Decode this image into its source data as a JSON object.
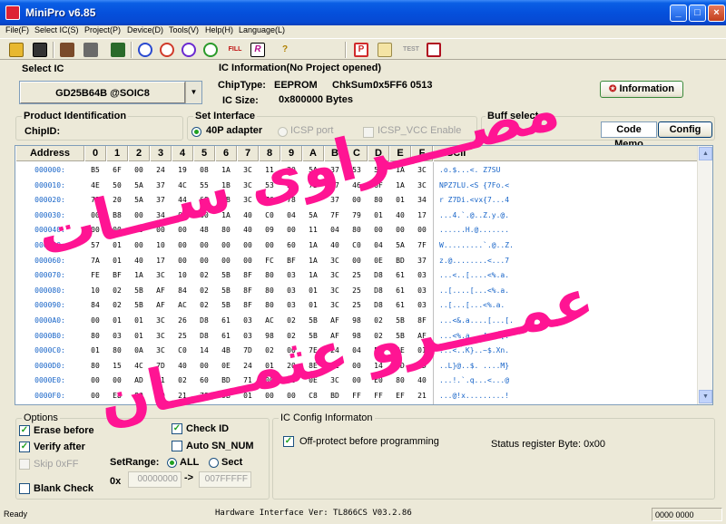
{
  "window": {
    "title": "MiniPro v6.85",
    "min": "_",
    "max": "□",
    "close": "×"
  },
  "menu": [
    "File(F)",
    "Select IC(S)",
    "Project(P)",
    "Device(D)",
    "Tools(V)",
    "Help(H)",
    "Language(L)"
  ],
  "toolbar": {
    "icons": [
      "open-icon",
      "save-icon",
      "project-icon",
      "save-project-icon",
      "chip-icon",
      "read-icon",
      "erase-icon",
      "blank-icon",
      "verify-icon",
      "fill-icon",
      "edit-icon",
      "help-icon",
      "program-icon",
      "notes-icon",
      "test-icon",
      "chip-test-icon"
    ],
    "fill_label": "FILL",
    "test_label": "TEST"
  },
  "select_ic": {
    "label": "Select IC",
    "value": "GD25B64B @SOIC8"
  },
  "ic_info": {
    "label": "IC Information(No Project opened)",
    "chiptype_label": "ChipType:",
    "chiptype": "EEPROM",
    "checksum_label": "ChkSum:",
    "checksum": "0x5FF6 0513",
    "size_label": "IC Size:",
    "size": "0x800000 Bytes",
    "info_button": "Information"
  },
  "product": {
    "label": "Product Identification",
    "chipid_label": "ChipID:"
  },
  "interface": {
    "label": "Set Interface",
    "opt1": "40P adapter",
    "opt2": "ICSP port",
    "icsp_vcc": "ICSP_VCC Enable"
  },
  "buff": {
    "label": "Buff select",
    "code_memo": "Code Memo",
    "config": "Config"
  },
  "hex": {
    "headers": [
      "Address",
      "0",
      "1",
      "2",
      "3",
      "4",
      "5",
      "6",
      "7",
      "8",
      "9",
      "A",
      "B",
      "C",
      "D",
      "E",
      "F",
      "ASCII"
    ],
    "rows": [
      {
        "addr": "000000:",
        "bytes": [
          "B5",
          "6F",
          "00",
          "24",
          "19",
          "08",
          "1A",
          "3C",
          "11",
          "20",
          "5A",
          "37",
          "53",
          "55",
          "1A",
          "3C"
        ],
        "ascii": ".o.$...<. Z7SU"
      },
      {
        "addr": "000010:",
        "bytes": [
          "4E",
          "50",
          "5A",
          "37",
          "4C",
          "55",
          "1B",
          "3C",
          "53",
          "20",
          "7B",
          "37",
          "46",
          "6F",
          "1A",
          "3C"
        ],
        "ascii": "NPZ7LU.<S {7Fo.<"
      },
      {
        "addr": "000020:",
        "bytes": [
          "72",
          "20",
          "5A",
          "37",
          "44",
          "69",
          "1B",
          "3C",
          "76",
          "78",
          "7B",
          "37",
          "00",
          "80",
          "01",
          "34"
        ],
        "ascii": "r Z7Di.<vx{7...4"
      },
      {
        "addr": "000030:",
        "bytes": [
          "00",
          "B8",
          "00",
          "34",
          "00",
          "60",
          "1A",
          "40",
          "C0",
          "04",
          "5A",
          "7F",
          "79",
          "01",
          "40",
          "17"
        ],
        "ascii": "...4.`.@..Z.y.@."
      },
      {
        "addr": "000040:",
        "bytes": [
          "00",
          "00",
          "00",
          "00",
          "00",
          "48",
          "80",
          "40",
          "09",
          "00",
          "11",
          "04",
          "80",
          "00",
          "00",
          "00"
        ],
        "ascii": "......H.@......."
      },
      {
        "addr": "000050:",
        "bytes": [
          "57",
          "01",
          "00",
          "10",
          "00",
          "00",
          "00",
          "00",
          "00",
          "60",
          "1A",
          "40",
          "C0",
          "04",
          "5A",
          "7F"
        ],
        "ascii": "W.........`.@..Z."
      },
      {
        "addr": "000060:",
        "bytes": [
          "7A",
          "01",
          "40",
          "17",
          "00",
          "00",
          "00",
          "00",
          "FC",
          "BF",
          "1A",
          "3C",
          "00",
          "0E",
          "BD",
          "37"
        ],
        "ascii": "z.@........<...7"
      },
      {
        "addr": "000070:",
        "bytes": [
          "FE",
          "BF",
          "1A",
          "3C",
          "10",
          "02",
          "5B",
          "8F",
          "80",
          "03",
          "1A",
          "3C",
          "25",
          "D8",
          "61",
          "03"
        ],
        "ascii": "...<..[....<%.a."
      },
      {
        "addr": "000080:",
        "bytes": [
          "10",
          "02",
          "5B",
          "AF",
          "84",
          "02",
          "5B",
          "8F",
          "80",
          "03",
          "01",
          "3C",
          "25",
          "D8",
          "61",
          "03"
        ],
        "ascii": "..[....[...<%.a."
      },
      {
        "addr": "000090:",
        "bytes": [
          "84",
          "02",
          "5B",
          "AF",
          "AC",
          "02",
          "5B",
          "8F",
          "80",
          "03",
          "01",
          "3C",
          "25",
          "D8",
          "61",
          "03"
        ],
        "ascii": "..[...[...<%.a."
      },
      {
        "addr": "0000A0:",
        "bytes": [
          "00",
          "01",
          "01",
          "3C",
          "26",
          "D8",
          "61",
          "03",
          "AC",
          "02",
          "5B",
          "AF",
          "98",
          "02",
          "5B",
          "8F"
        ],
        "ascii": "...<&.a....[...[."
      },
      {
        "addr": "0000B0:",
        "bytes": [
          "80",
          "03",
          "01",
          "3C",
          "25",
          "D8",
          "61",
          "03",
          "98",
          "02",
          "5B",
          "AF",
          "98",
          "02",
          "5B",
          "AF"
        ],
        "ascii": "...<%.a...[...[."
      },
      {
        "addr": "0000C0:",
        "bytes": [
          "01",
          "80",
          "0A",
          "3C",
          "C0",
          "14",
          "4B",
          "7D",
          "02",
          "00",
          "7E",
          "24",
          "04",
          "58",
          "6E",
          "01"
        ],
        "ascii": "...<..K}..~$.Xn."
      },
      {
        "addr": "0000D0:",
        "bytes": [
          "80",
          "15",
          "4C",
          "7D",
          "40",
          "00",
          "0E",
          "24",
          "01",
          "20",
          "8E",
          "01",
          "00",
          "14",
          "4D",
          "7D"
        ],
        "ascii": "..L}@..$. ....M}"
      },
      {
        "addr": "0000E0:",
        "bytes": [
          "00",
          "00",
          "AD",
          "21",
          "02",
          "60",
          "BD",
          "71",
          "00",
          "80",
          "0E",
          "3C",
          "00",
          "E0",
          "80",
          "40"
        ],
        "ascii": "...!.`.q...<...@"
      },
      {
        "addr": "0000F0:",
        "bytes": [
          "00",
          "E8",
          "80",
          "40",
          "21",
          "78",
          "9B",
          "01",
          "00",
          "00",
          "C8",
          "BD",
          "FF",
          "FF",
          "EF",
          "21"
        ],
        "ascii": "...@!x.........!"
      }
    ]
  },
  "options": {
    "label": "Options",
    "erase": "Erase before",
    "verify": "Verify after",
    "skip": "Skip 0xFF",
    "blank": "Blank Check",
    "check_id": "Check ID",
    "auto_sn": "Auto SN_NUM",
    "setrange_label": "SetRange:",
    "range_all": "ALL",
    "range_sect": "Sect",
    "prefix": "0x",
    "range_start": "00000000",
    "arrow": "->",
    "range_end": "007FFFFF"
  },
  "ic_config": {
    "label": "IC Config Informaton",
    "off_protect": "Off-protect before programming",
    "status": "Status register Byte: 0x00"
  },
  "status": {
    "ready": "Ready",
    "hw": "Hardware Interface Ver: TL866CS V03.2.86",
    "code": "0000 0000"
  },
  "watermark": {
    "line1": "مصــــراوى ســـات",
    "line2": "عمــــرو عثمــــان",
    "color": "#ff1493"
  },
  "colors": {
    "title_blue": "#0550dc",
    "address_blue": "#1764c8",
    "window_bg": "#ece9d8"
  }
}
